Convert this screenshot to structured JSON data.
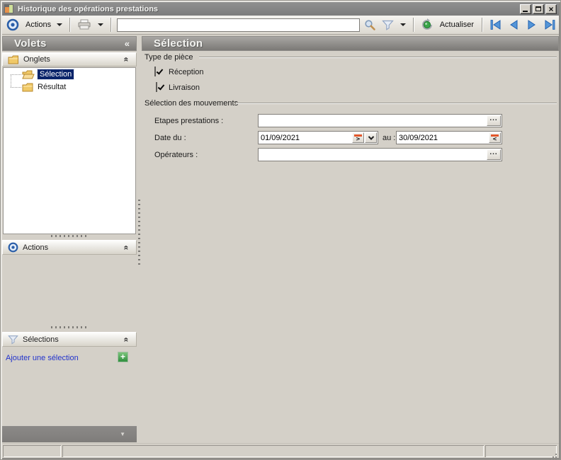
{
  "window": {
    "title": "Historique des opérations prestations"
  },
  "toolbar": {
    "actions_label": "Actions",
    "search_value": "",
    "refresh_label": "Actualiser"
  },
  "sidebar": {
    "title": "Volets",
    "onglets": {
      "label": "Onglets"
    },
    "actions": {
      "label": "Actions"
    },
    "selections": {
      "label": "Sélections",
      "add_label": "Ajouter une sélection"
    },
    "tree": [
      {
        "label": "Sélection",
        "selected": true
      },
      {
        "label": "Résultat",
        "selected": false
      }
    ]
  },
  "main": {
    "title": "Sélection",
    "group_piece": {
      "label": "Type de pièce"
    },
    "group_mouvements": {
      "label": "Sélection des mouvements"
    },
    "checkboxes": [
      {
        "label": "Réception",
        "checked": true
      },
      {
        "label": "Livraison",
        "checked": true
      }
    ],
    "fields": {
      "etapes_label": "Etapes prestations :",
      "etapes_value": "",
      "date_du_label": "Date du :",
      "date_du_value": "01/09/2021",
      "au_label": "au :",
      "date_au_value": "30/09/2021",
      "operateurs_label": "Opérateurs :",
      "operateurs_value": ""
    }
  },
  "glyphs": {
    "collapse_left": "«",
    "section_collapse": "«",
    "panel_arrow_down": "▼",
    "ellipsis": "...",
    "date_next": ">",
    "date_prev": "<",
    "plus": "+"
  },
  "colors": {
    "window_bg": "#d4d0c8",
    "titlebar": "#868686",
    "header_gradient_top": "#a8a6a3",
    "header_gradient_bottom": "#7b7976",
    "selection_bg": "#0a246a",
    "link": "#2233cc",
    "accent_blue": "#2a5ea8",
    "nav_blue": "#5596d8",
    "green": "#2f9e3f",
    "orange": "#e2572b"
  }
}
